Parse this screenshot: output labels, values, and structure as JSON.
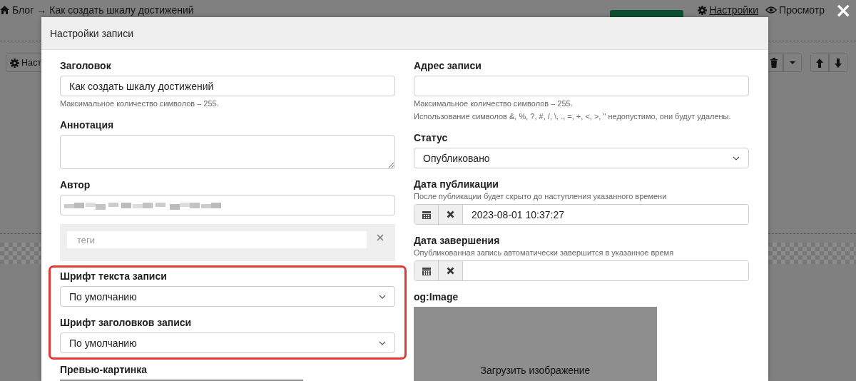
{
  "background": {
    "breadcrumb": {
      "home": "Блог",
      "arrow": "→",
      "title": "Как создать шкалу достижений"
    },
    "links": [
      {
        "label": "Настройки"
      },
      {
        "label": "Просмотр"
      }
    ],
    "toolbar_button": "Наст"
  },
  "close": "×",
  "modal": {
    "title": "Настройки записи",
    "left": [
      {
        "kind": "text",
        "label": "Заголовок",
        "value": "Как создать шкалу достижений",
        "help": [
          "Максимальное количество символов – 255."
        ]
      },
      {
        "kind": "textarea",
        "label": "Аннотация"
      },
      {
        "kind": "text",
        "label": "Автор",
        "redacted": true
      },
      {
        "kind": "tags",
        "placeholder": "теги"
      },
      {
        "kind": "highlight",
        "fields": [
          {
            "kind": "select",
            "label": "Шрифт текста записи",
            "value": "По умолчанию"
          },
          {
            "kind": "select",
            "label": "Шрифт заголовков записи",
            "value": "По умолчанию"
          }
        ]
      },
      {
        "kind": "preview",
        "label": "Превью-картинка"
      }
    ],
    "right": [
      {
        "kind": "text",
        "label": "Адрес записи",
        "help": [
          "Максимальное количество символов – 255.",
          "Использование символов &, %, ?, #, /, \\, ., =, +, <, >, \" недопустимо, они будут удалены."
        ]
      },
      {
        "kind": "select",
        "label": "Статус",
        "value": "Опубликовано"
      },
      {
        "kind": "date",
        "label": "Дата публикации",
        "hint": "После публикации будет скрыто до наступления указанного времени",
        "value": "2023-08-01 10:37:27"
      },
      {
        "kind": "date",
        "label": "Дата завершения",
        "hint": "Опубликованная запись автоматически завершится в указанное время"
      },
      {
        "kind": "image",
        "label": "og:Image",
        "button": "Загрузить изображение"
      }
    ]
  }
}
